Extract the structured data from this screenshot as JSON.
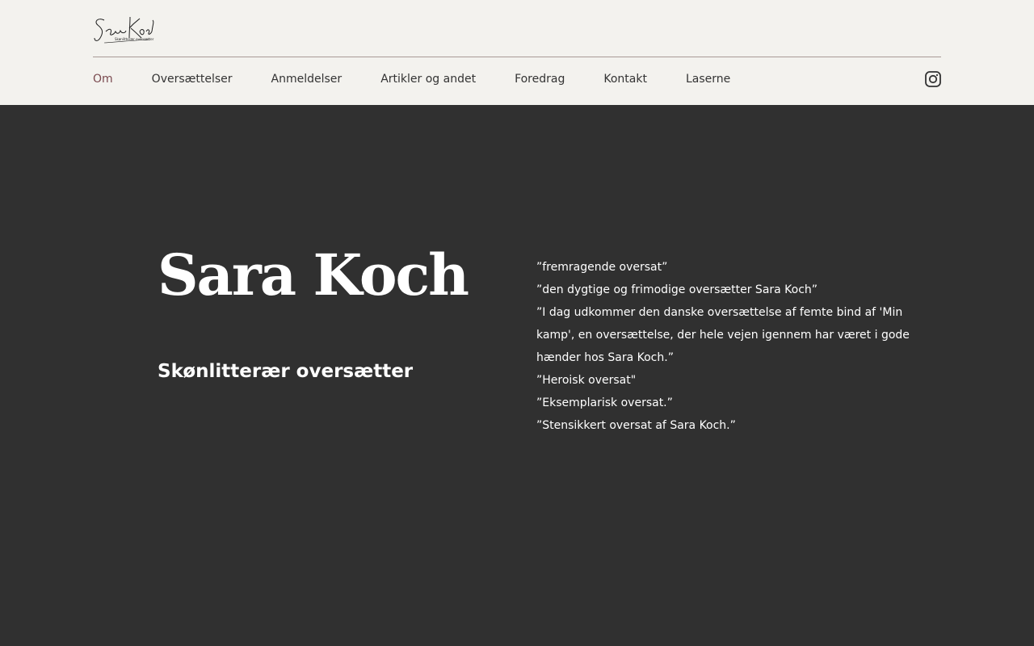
{
  "logo": {
    "script": "Sara Koch",
    "tagline": "Skønlitterær oversætter"
  },
  "nav": {
    "items": [
      {
        "label": "Om",
        "active": true
      },
      {
        "label": "Oversættelser"
      },
      {
        "label": "Anmeldelser"
      },
      {
        "label": "Artikler og andet"
      },
      {
        "label": "Foredrag"
      },
      {
        "label": "Kontakt"
      },
      {
        "label": "Laserne"
      }
    ],
    "social_icon": "instagram-icon"
  },
  "hero": {
    "name": "Sara Koch",
    "subtitle": "Skønlitterær oversætter"
  },
  "quotes": [
    "”fremragende oversat”",
    "”den dygtige og frimodige oversætter Sara Koch”",
    "”I dag udkommer den danske oversættelse af femte bind af 'Min kamp', en oversættelse, der hele vejen igennem har været i gode hænder hos Sara Koch.”",
    "”Heroisk oversat\"",
    "”Eksemplarisk oversat.”",
    "”Stensikkert oversat af Sara Koch.”"
  ],
  "colors": {
    "header_bg": "#f3f2ee",
    "main_bg": "#303030",
    "nav_active": "#7a4a4f",
    "divider": "#a89a96"
  }
}
